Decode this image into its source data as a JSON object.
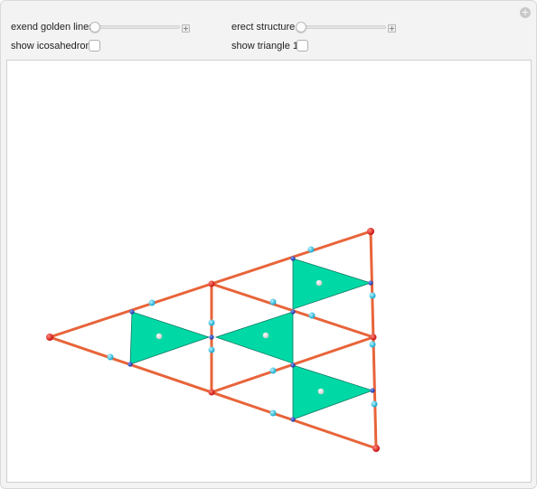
{
  "controls": {
    "golden_lines": {
      "label": "exend golden lines",
      "value": 0
    },
    "erect_structure": {
      "label": "erect structure",
      "value": 0
    },
    "show_icosahedron": {
      "label": "show icosahedron",
      "checked": false
    },
    "show_triangle1": {
      "label": "show triangle 1",
      "checked": false
    }
  },
  "icons": {
    "corner": "plus-circle-icon",
    "slider_increment": "plus-box-icon"
  },
  "colors": {
    "panel_bg": "#f3f3f3",
    "edge": "#e8643a",
    "face": "#00d9a6",
    "vertex_red": "#d81e1e",
    "midpoint_cyan": "#2ec8e6",
    "junction_blue": "#2244bb",
    "center_white": "#f4f4f4"
  }
}
